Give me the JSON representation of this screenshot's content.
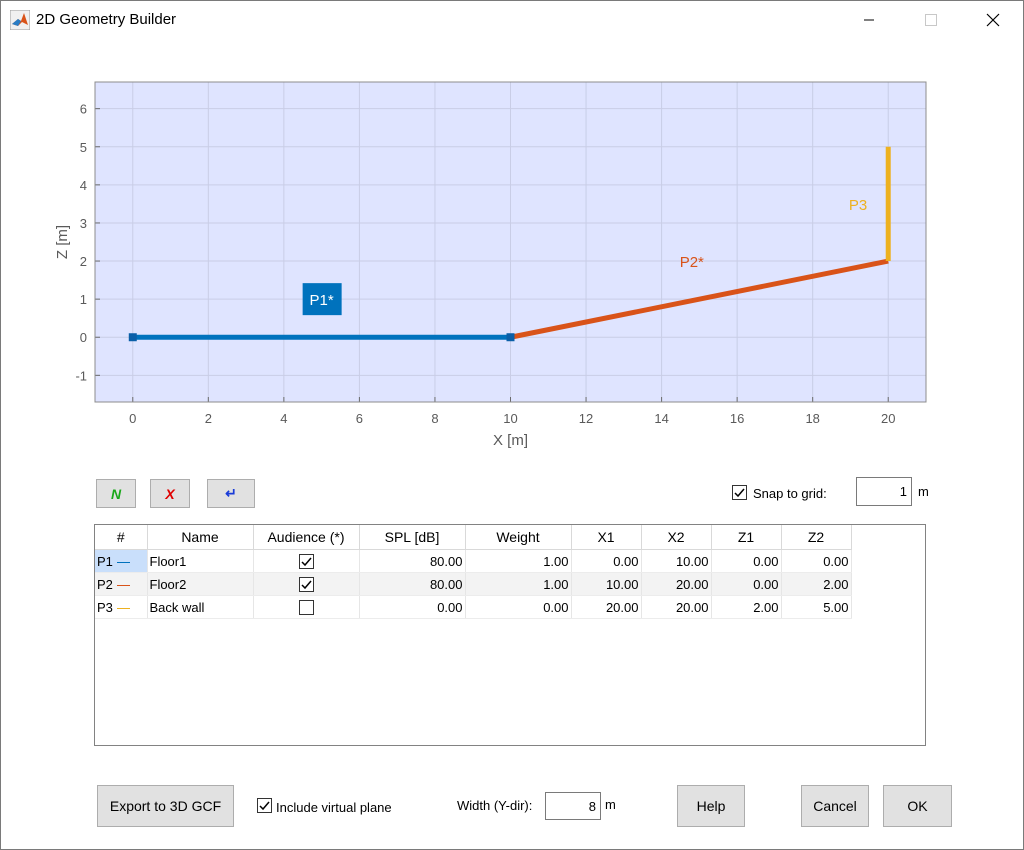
{
  "window": {
    "title": "2D Geometry Builder"
  },
  "chart_data": {
    "type": "line",
    "xlabel": "X [m]",
    "ylabel": "Z [m]",
    "xlim": [
      -1,
      21
    ],
    "ylim": [
      -1.7,
      6.7
    ],
    "xticks": [
      0,
      2,
      4,
      6,
      8,
      10,
      12,
      14,
      16,
      18,
      20
    ],
    "yticks": [
      -1,
      0,
      1,
      2,
      3,
      4,
      5,
      6
    ],
    "grid": true,
    "background": "#dfe4ff",
    "series": [
      {
        "name": "P1*",
        "x": [
          0,
          10
        ],
        "y": [
          0,
          0
        ],
        "color": "#0072bd",
        "label_highlighted": true,
        "label_pos": [
          5,
          1
        ]
      },
      {
        "name": "P2*",
        "x": [
          10,
          20
        ],
        "y": [
          0,
          2
        ],
        "color": "#d95319",
        "label_highlighted": false,
        "label_pos": [
          14.8,
          2
        ]
      },
      {
        "name": "P3",
        "x": [
          20,
          20
        ],
        "y": [
          2,
          5
        ],
        "color": "#edb120",
        "label_highlighted": false,
        "label_pos": [
          19.2,
          3.5
        ]
      }
    ],
    "markers": [
      {
        "x": 0,
        "y": 0
      },
      {
        "x": 10,
        "y": 0
      }
    ]
  },
  "toolbar": {
    "new_label": "N",
    "delete_label": "X",
    "enter_label": "↵"
  },
  "snap": {
    "label": "Snap to grid:",
    "checked": true,
    "value": "1",
    "unit": "m"
  },
  "table": {
    "columns": [
      "#",
      "Name",
      "Audience (*)",
      "SPL [dB]",
      "Weight",
      "X1",
      "X2",
      "Z1",
      "Z2"
    ],
    "rows": [
      {
        "id": "P1",
        "color": "#0072bd",
        "name": "Floor1",
        "audience": true,
        "spl": "80.00",
        "weight": "1.00",
        "x1": "0.00",
        "x2": "10.00",
        "z1": "0.00",
        "z2": "0.00"
      },
      {
        "id": "P2",
        "color": "#d95319",
        "name": "Floor2",
        "audience": true,
        "spl": "80.00",
        "weight": "1.00",
        "x1": "10.00",
        "x2": "20.00",
        "z1": "0.00",
        "z2": "2.00"
      },
      {
        "id": "P3",
        "color": "#edb120",
        "name": "Back wall",
        "audience": false,
        "spl": "0.00",
        "weight": "0.00",
        "x1": "20.00",
        "x2": "20.00",
        "z1": "2.00",
        "z2": "5.00"
      }
    ]
  },
  "bottom": {
    "export_label": "Export to 3D GCF",
    "virtual_label": "Include virtual plane",
    "virtual_checked": true,
    "width_label": "Width (Y-dir):",
    "width_value": "8",
    "width_unit": "m",
    "help_label": "Help",
    "cancel_label": "Cancel",
    "ok_label": "OK"
  }
}
